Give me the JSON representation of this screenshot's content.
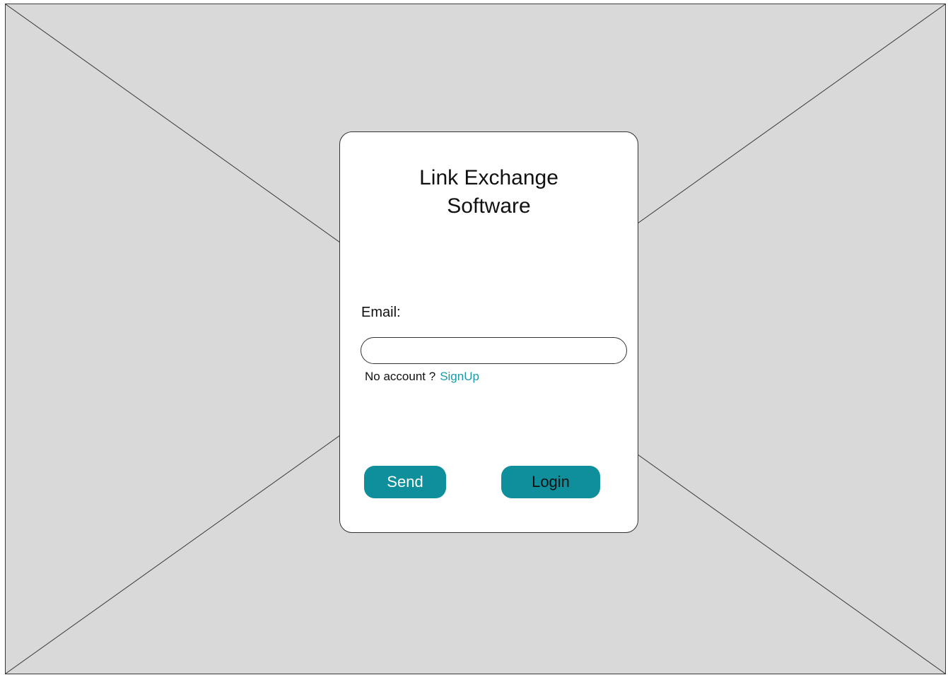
{
  "card": {
    "title": "Link Exchange\nSoftware"
  },
  "form": {
    "email_label": "Email:",
    "email_value": "",
    "email_placeholder": "",
    "no_account_text": "No account ?",
    "signup_link": "SignUp",
    "send_label": "Send",
    "login_label": "Login"
  },
  "colors": {
    "accent": "#0f8f9c",
    "link": "#1a9aa8",
    "placeholder_background": "#d9d9d9",
    "card_background": "#ffffff"
  }
}
